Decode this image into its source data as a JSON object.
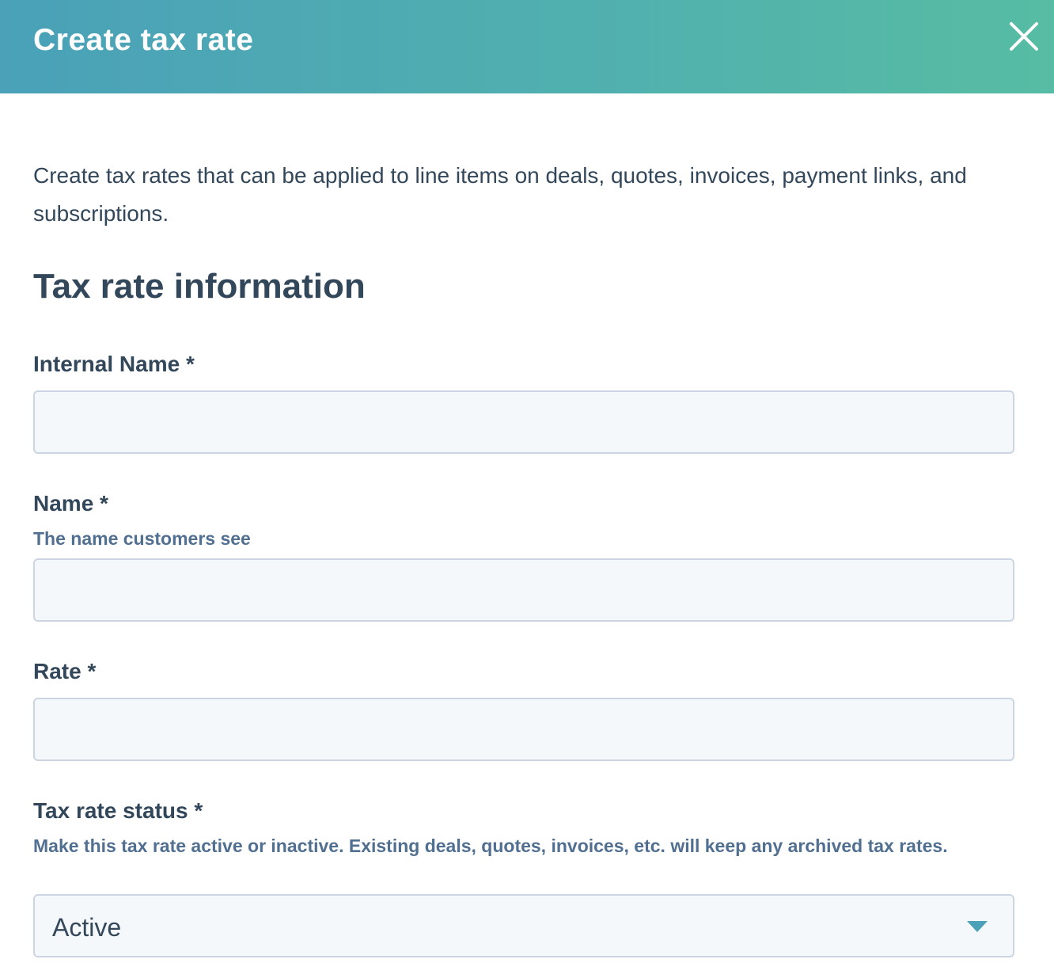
{
  "dialog": {
    "title": "Create tax rate",
    "close_label": "Close",
    "intro": "Create tax rates that can be applied to line items on deals, quotes, invoices, payment links, and subscriptions."
  },
  "section": {
    "title": "Tax rate information"
  },
  "fields": {
    "internal_name": {
      "label": "Internal Name *",
      "value": "",
      "placeholder": ""
    },
    "name": {
      "label": "Name *",
      "help": "The name customers see",
      "value": "",
      "placeholder": ""
    },
    "rate": {
      "label": "Rate *",
      "value": "",
      "placeholder": ""
    },
    "status": {
      "label": "Tax rate status *",
      "help": "Make this tax rate active or inactive. Existing deals, quotes, invoices, etc. will keep any archived tax rates.",
      "selected": "Active"
    }
  },
  "icons": {
    "close": "close-icon",
    "dropdown": "caret-down-icon"
  },
  "colors": {
    "header_gradient_start": "#4aa1b8",
    "header_gradient_end": "#57bca3",
    "text": "#33475b",
    "help_text": "#516f90",
    "input_bg": "#f5f8fa",
    "input_border": "#cbd6e2",
    "caret": "#4aa1b8"
  }
}
